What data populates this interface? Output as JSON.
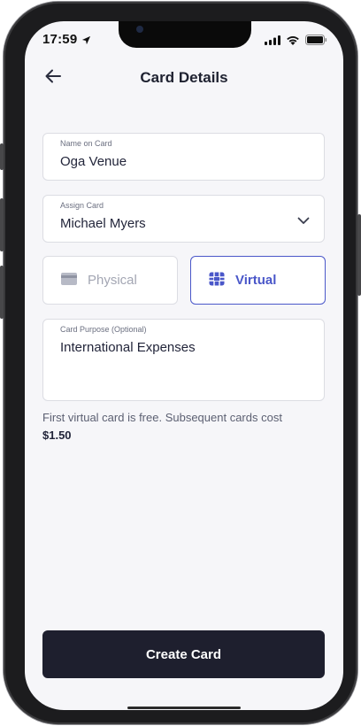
{
  "status_bar": {
    "time": "17:59"
  },
  "header": {
    "title": "Card Details"
  },
  "form": {
    "name_on_card": {
      "label": "Name on Card",
      "value": "Oga Venue"
    },
    "assign_card": {
      "label": "Assign Card",
      "value": "Michael Myers"
    },
    "card_type": {
      "options": [
        {
          "label": "Physical",
          "icon": "card-icon",
          "selected": false
        },
        {
          "label": "Virtual",
          "icon": "chip-icon",
          "selected": true
        }
      ]
    },
    "card_purpose": {
      "label": "Card Purpose (Optional)",
      "value": "International Expenses"
    }
  },
  "note": {
    "text": "First virtual card is free. Subsequent cards cost",
    "price": "$1.50"
  },
  "actions": {
    "create_label": "Create Card"
  },
  "colors": {
    "accent": "#4a57c9",
    "primary_button": "#1e1f2e",
    "background": "#f6f6f9"
  }
}
